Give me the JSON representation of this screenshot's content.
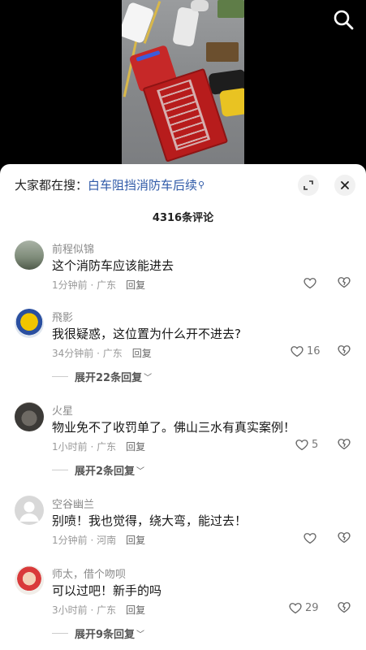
{
  "header": {
    "hot_prefix": "大家都在搜：",
    "hot_keyword": "白车阻挡消防车后续",
    "comment_count": "4316条评论"
  },
  "comments": [
    {
      "name": "前程似锦",
      "text": "这个消防车应该能进去",
      "time": "1分钟前 · 广东",
      "reply": "回复",
      "likes": "",
      "expand": ""
    },
    {
      "name": "飛影",
      "text": "我很疑惑，这位置为什么开不进去?",
      "time": "34分钟前 · 广东",
      "reply": "回复",
      "likes": "16",
      "expand": "展开22条回复"
    },
    {
      "name": "火星",
      "text": "物业免不了收罚单了。佛山三水有真实案例！",
      "time": "1小时前 · 广东",
      "reply": "回复",
      "likes": "5",
      "expand": "展开2条回复"
    },
    {
      "name": "空谷幽兰",
      "text": "别喷！我也觉得，绕大弯，能过去！",
      "time": "1分钟前 · 河南",
      "reply": "回复",
      "likes": "",
      "expand": ""
    },
    {
      "name": "师太，借个吻呗",
      "text": "可以过吧！新手的吗",
      "time": "3小时前 · 广东",
      "reply": "回复",
      "likes": "29",
      "expand": "展开9条回复"
    }
  ],
  "colors": {
    "keyword": "#2f5aa8",
    "text": "#161616",
    "meta": "#999999"
  }
}
